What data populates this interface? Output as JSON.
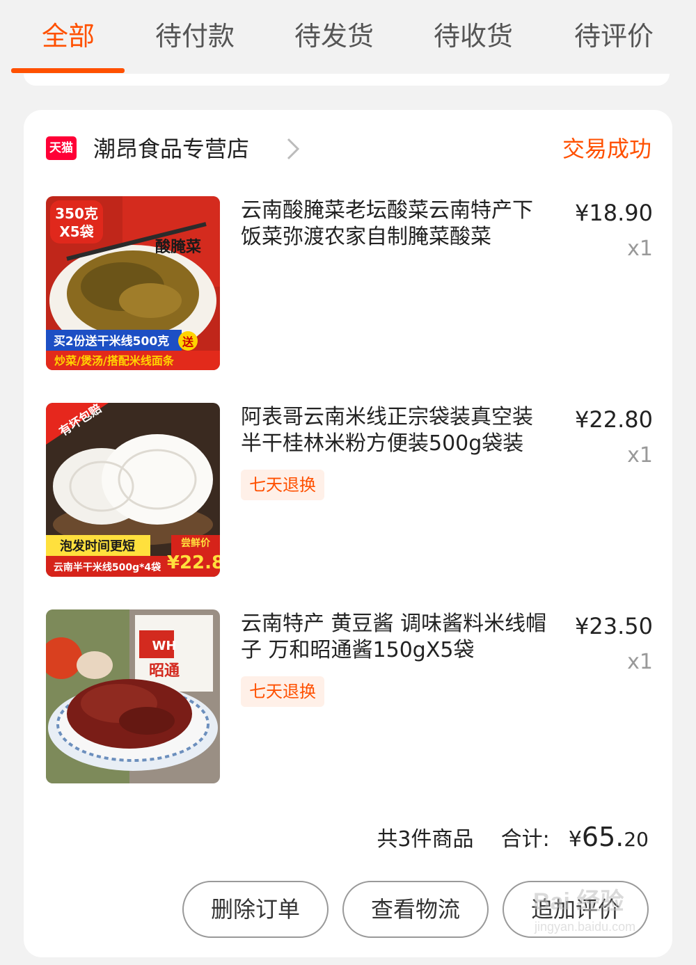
{
  "tabs": [
    {
      "label": "全部",
      "active": true
    },
    {
      "label": "待付款",
      "active": false
    },
    {
      "label": "待发货",
      "active": false
    },
    {
      "label": "待收货",
      "active": false
    },
    {
      "label": "待评价",
      "active": false
    }
  ],
  "order": {
    "store_badge": "天猫",
    "store_name": "潮昂食品专营店",
    "status": "交易成功",
    "items": [
      {
        "title": "云南酸腌菜老坛酸菜云南特产下饭菜弥渡农家自制腌菜酸菜",
        "price": "¥18.90",
        "qty": "x1",
        "tag": "",
        "image_text": {
          "badge_top": "350克",
          "badge_bottom": "X5袋",
          "banner_1": "买2份送干米线500克",
          "banner_1_tag": "送",
          "banner_2": "炒菜/煲汤/搭配米线面条",
          "pack_label": "酸腌菜"
        }
      },
      {
        "title": "阿表哥云南米线正宗袋装真空装半干桂林米粉方便装500g袋装",
        "price": "¥22.80",
        "qty": "x1",
        "tag": "七天退换",
        "image_text": {
          "ribbon": "有坏包赔",
          "banner_1": "泡发时间更短",
          "banner_2": "云南半干米线500g*4袋",
          "promo_label": "尝鲜价",
          "promo_price": "¥22.8"
        }
      },
      {
        "title": "云南特产 黄豆酱 调味酱料米线帽子 万和昭通酱150gX5袋",
        "price": "¥23.50",
        "qty": "x1",
        "tag": "七天退换",
        "image_text": {
          "pack_brand": "WH",
          "pack_label": "昭通"
        }
      }
    ],
    "summary": {
      "count_text": "共3件商品",
      "total_label": "合计:",
      "currency": "¥",
      "total_int": "65.",
      "total_dec": "20"
    },
    "actions": {
      "delete": "删除订单",
      "logistics": "查看物流",
      "review": "追加评价"
    }
  },
  "watermark": {
    "brand": "Bai 经验",
    "url": "jingyan.baidu.com"
  },
  "colors": {
    "accent": "#ff5000",
    "tmall": "#ff0036",
    "tag_bg": "#fff0e8"
  }
}
